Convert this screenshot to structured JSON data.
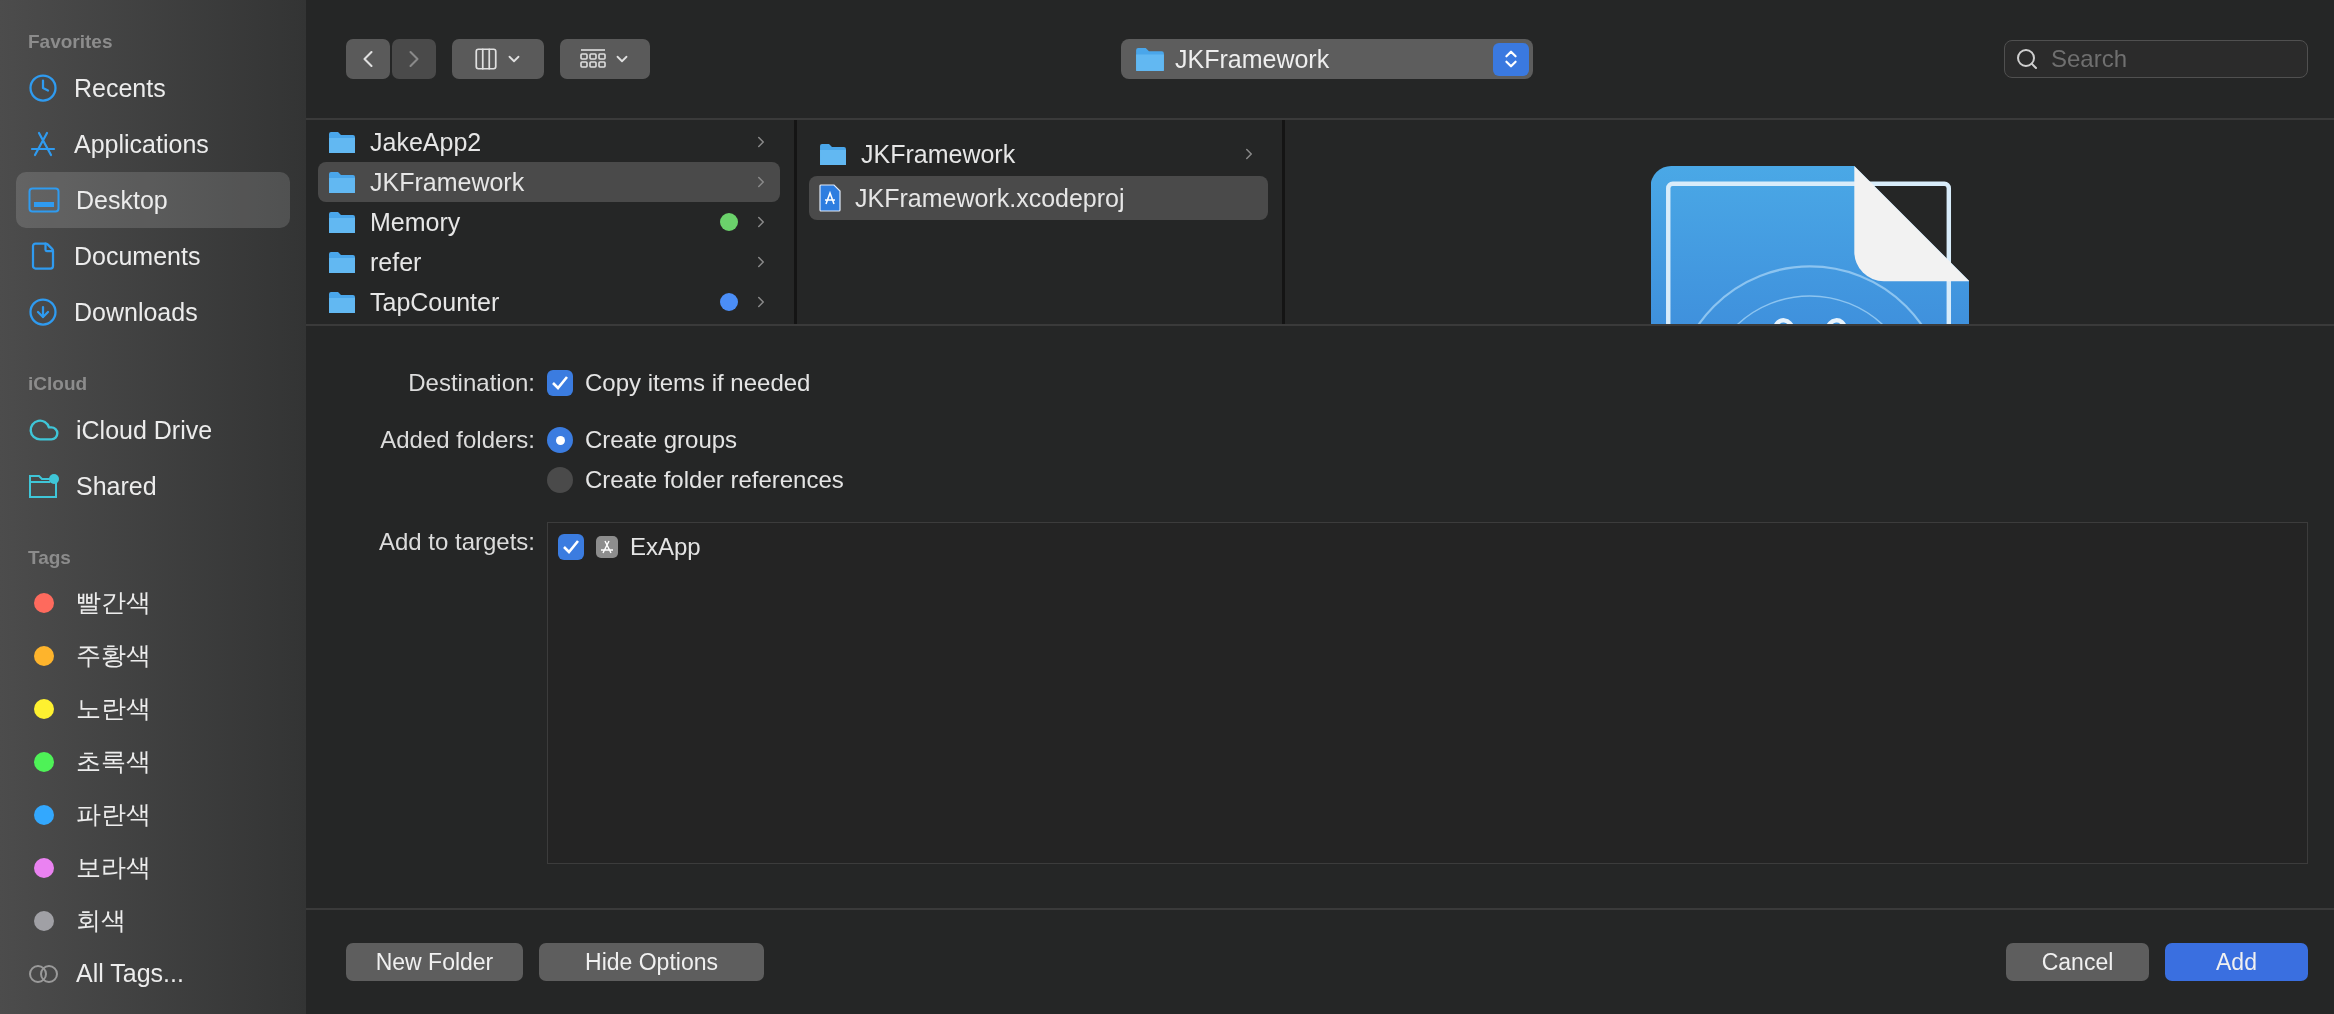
{
  "sidebar": {
    "sections": [
      {
        "title": "Favorites",
        "items": [
          {
            "kind": "place",
            "label": "Recents",
            "selected": false
          },
          {
            "kind": "place",
            "label": "Applications",
            "selected": false
          },
          {
            "kind": "place",
            "label": "Desktop",
            "selected": true
          },
          {
            "kind": "place",
            "label": "Documents",
            "selected": false
          },
          {
            "kind": "place",
            "label": "Downloads",
            "selected": false
          }
        ]
      },
      {
        "title": "iCloud",
        "items": [
          {
            "kind": "place",
            "label": "iCloud Drive",
            "selected": false
          },
          {
            "kind": "place",
            "label": "Shared",
            "selected": false
          }
        ]
      },
      {
        "title": "Tags",
        "items": [
          {
            "kind": "tag",
            "label": "빨간색",
            "color": "#fe6a5d",
            "selected": false
          },
          {
            "kind": "tag",
            "label": "주황색",
            "color": "#feb42c",
            "selected": false
          },
          {
            "kind": "tag",
            "label": "노란색",
            "color": "#fef130",
            "selected": false
          },
          {
            "kind": "tag",
            "label": "초록색",
            "color": "#4ef257",
            "selected": false
          },
          {
            "kind": "tag",
            "label": "파란색",
            "color": "#33a8fe",
            "selected": false
          },
          {
            "kind": "tag",
            "label": "보라색",
            "color": "#ea82f1",
            "selected": false
          },
          {
            "kind": "tag",
            "label": "회색",
            "color": "#a0a0a5",
            "selected": false
          },
          {
            "kind": "all_tags",
            "label": "All Tags...",
            "selected": false
          }
        ]
      }
    ]
  },
  "toolbar": {
    "back_enabled": true,
    "forward_enabled": false,
    "path": "JKFramework",
    "search": {
      "placeholder": "Search"
    }
  },
  "browser": {
    "columns": [
      {
        "items": [
          {
            "kind": "folder",
            "label": "JakeApp2",
            "selected": false
          },
          {
            "kind": "folder",
            "label": "JKFramework",
            "selected": true
          },
          {
            "kind": "folder",
            "label": "Memory",
            "color": "#6bd26b",
            "selected": false
          },
          {
            "kind": "folder",
            "label": "refer",
            "selected": false
          },
          {
            "kind": "folder",
            "label": "TapCounter",
            "color": "#4b8ef7",
            "selected": false
          }
        ]
      },
      {
        "items": [
          {
            "kind": "folder",
            "label": "JKFramework",
            "selected": false
          },
          {
            "kind": "project",
            "label": "JKFramework.xcodeproj",
            "selected": true
          }
        ]
      }
    ]
  },
  "options": {
    "destination": {
      "label": "Destination:",
      "option": "Copy items if needed",
      "checked": true
    },
    "added_folders": {
      "label": "Added folders:",
      "choices": [
        {
          "label": "Create groups",
          "selected": true
        },
        {
          "label": "Create folder references",
          "selected": false
        }
      ]
    },
    "targets": {
      "label": "Add to targets:",
      "items": [
        {
          "label": "ExApp",
          "checked": true
        }
      ]
    }
  },
  "buttons_left": [
    {
      "label": "New Folder"
    },
    {
      "label": "Hide Options"
    }
  ],
  "buttons_right": [
    {
      "label": "Cancel",
      "kind": "default"
    },
    {
      "label": "Add",
      "kind": "primary"
    }
  ]
}
